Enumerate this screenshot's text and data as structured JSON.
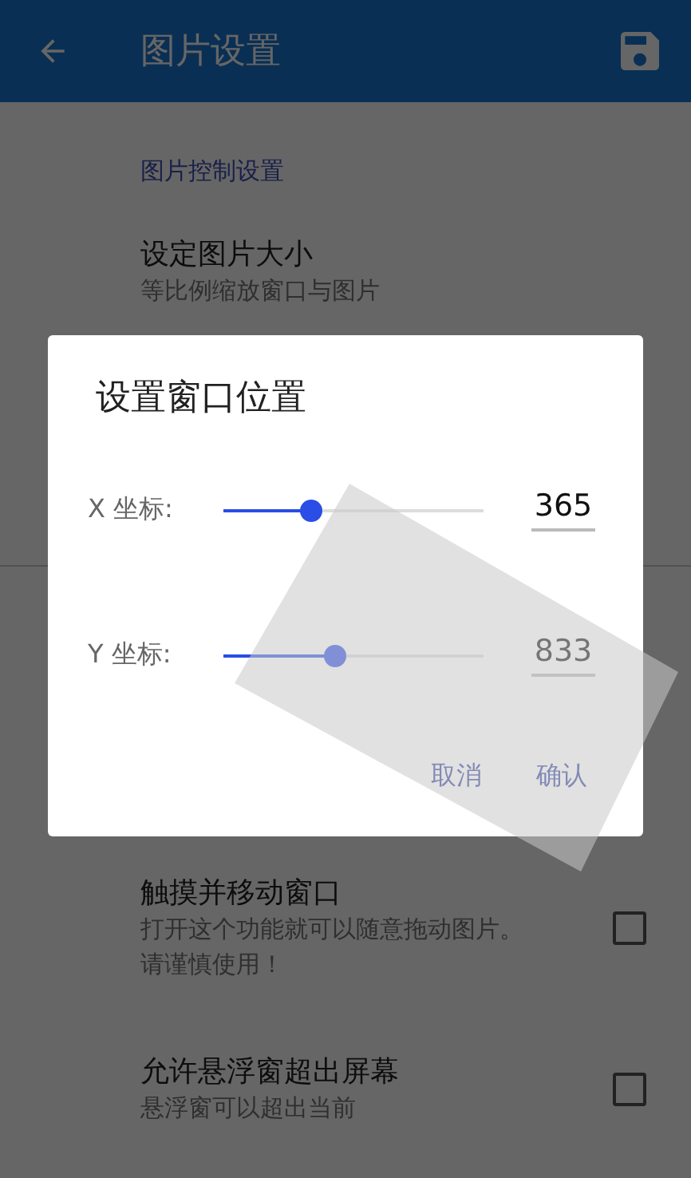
{
  "app_bar": {
    "title": "图片设置"
  },
  "top_items": [
    {
      "kind": "header",
      "title": "图片控制设置"
    },
    {
      "kind": "plain",
      "title": "设定图片大小",
      "subtitle": "等比例缩放窗口与图片"
    }
  ],
  "bottom_items": [
    {
      "kind": "checkbox",
      "title": "触摸并移动窗口",
      "subtitle": "打开这个功能就可以随意拖动图片。请谨慎使用！",
      "checked": false
    },
    {
      "kind": "checkbox",
      "title": "允许悬浮窗超出屏幕",
      "subtitle": "悬浮窗可以超出当前",
      "checked": false
    }
  ],
  "dialog": {
    "title": "设置窗口位置",
    "sliders": [
      {
        "label": "X 坐标:",
        "level": 0.34,
        "value": "365"
      },
      {
        "label": "Y 坐标:",
        "level": 0.43,
        "value": "833"
      }
    ],
    "buttons": [
      "取消",
      "确认"
    ]
  }
}
